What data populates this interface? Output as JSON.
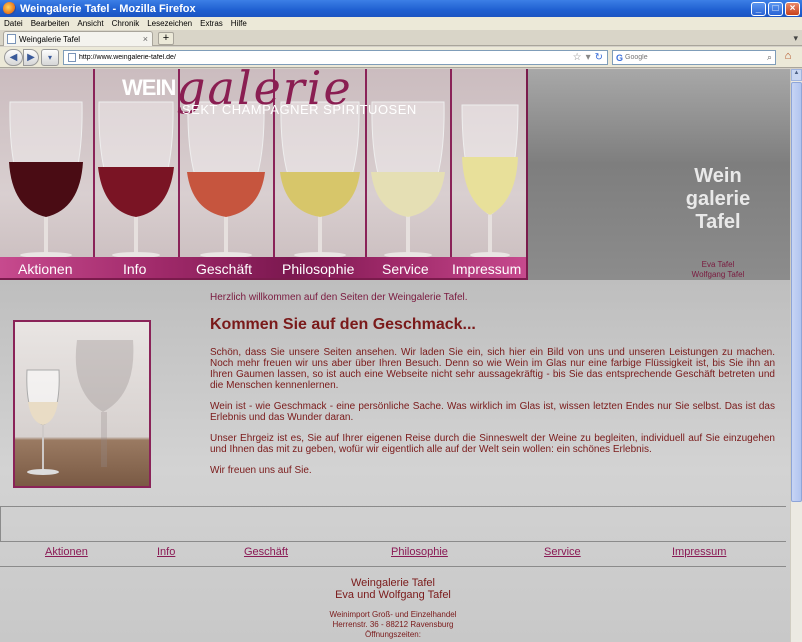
{
  "window": {
    "title": "Weingalerie Tafel - Mozilla Firefox"
  },
  "menu": [
    "Datei",
    "Bearbeiten",
    "Ansicht",
    "Chronik",
    "Lesezeichen",
    "Extras",
    "Hilfe"
  ],
  "tab": {
    "label": "Weingalerie Tafel"
  },
  "address": {
    "url": "http://www.weingalerie-tafel.de/"
  },
  "search": {
    "placeholder": "Google"
  },
  "logo": {
    "wein": "WEIN",
    "galerie": "galerie",
    "sub": "SEKT  CHAMPAGNER  SPIRITUOSEN"
  },
  "nav": [
    "Aktionen",
    "Info",
    "Geschäft",
    "Philosophie",
    "Service",
    "Impressum"
  ],
  "brand": {
    "line1": "Wein",
    "line2": "galerie",
    "line3": "Tafel",
    "owner1": "Eva Tafel",
    "owner2": "Wolfgang Tafel"
  },
  "content": {
    "welcome": "Herzlich willkommen auf den Seiten der Weingalerie Tafel.",
    "headline": "Kommen Sie auf den Geschmack...",
    "p1": "Schön, dass Sie unsere Seiten ansehen. Wir laden Sie ein, sich hier ein Bild von uns und unseren Leistungen zu machen. Noch mehr freuen wir uns aber über Ihren Besuch. Denn so wie Wein im Glas nur eine farbige Flüssigkeit ist, bis Sie ihn an Ihren Gaumen lassen, so ist auch eine Webseite nicht sehr aussagekräftig - bis Sie das entsprechende Geschäft betreten und die Menschen kennenlernen.",
    "p2": "Wein ist - wie Geschmack - eine persönliche Sache. Was wirklich im Glas ist, wissen letzten Endes nur Sie selbst. Das ist das Erlebnis und das Wunder daran.",
    "p3": "Unser Ehrgeiz ist es, Sie auf Ihrer eigenen Reise durch die Sinneswelt der Weine zu begleiten, individuell auf Sie einzugehen und Ihnen das mit zu geben, wofür wir eigentlich alle auf der Welt sein wollen: ein schönes Erlebnis.",
    "p4": "Wir freuen uns auf Sie."
  },
  "footer": {
    "nav": [
      "Aktionen",
      "Info",
      "Geschäft",
      "Philosophie",
      "Service",
      "Impressum"
    ],
    "name": "Weingalerie Tafel",
    "owners": "Eva und Wolfgang Tafel",
    "line1": "Weinimport Groß- und Einzelhandel",
    "line2": "Herrenstr. 36 - 88212 Ravensburg",
    "line3": "Öffnungszeiten:"
  },
  "colors": {
    "accent": "#8a1e52",
    "text": "#7a1a1a"
  }
}
